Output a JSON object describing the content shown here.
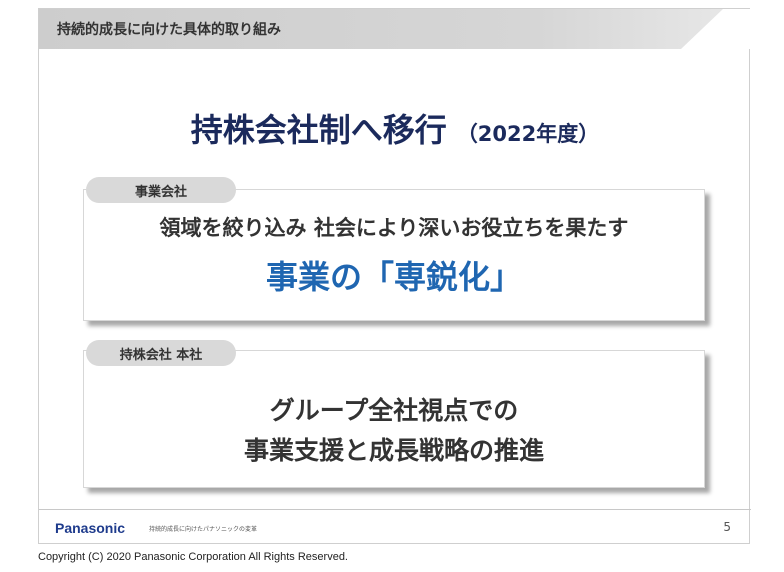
{
  "header": {
    "title": "持続的成長に向けた具体的取り組み"
  },
  "main": {
    "title": "持株会社制へ移行",
    "year": "（2022年度）"
  },
  "box1": {
    "tab": "事業会社",
    "line1": "領域を絞り込み 社会により深いお役立ちを果たす",
    "line2": "事業の「専鋭化」"
  },
  "box2": {
    "tab": "持株会社 本社",
    "line1": "グループ全社視点での",
    "line2": "事業支援と成長戦略の推進"
  },
  "footer": {
    "brand": "Panasonic",
    "subtitle": "持続的成長に向けたパナソニックの変革",
    "page": "5"
  },
  "copyright": "Copyright (C) 2020 Panasonic Corporation All Rights Reserved."
}
